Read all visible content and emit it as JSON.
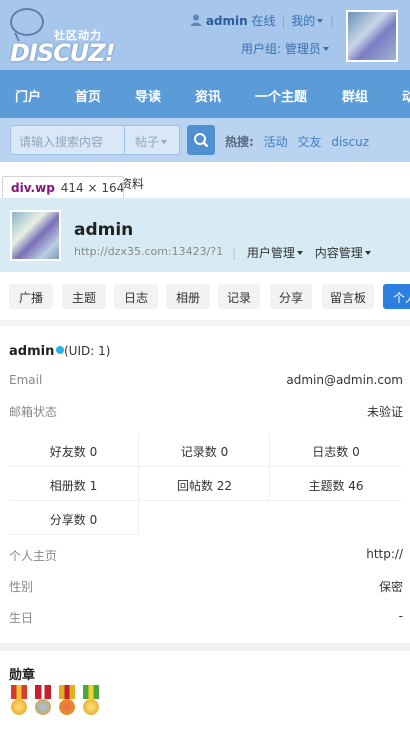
{
  "header": {
    "logo_cn": "社区动力",
    "logo_en": "DISCUZ!",
    "username": "admin",
    "online_status": "在线",
    "my_label": "我的",
    "user_group": "用户组: 管理员"
  },
  "nav": {
    "items": [
      "门户",
      "首页",
      "导读",
      "资讯",
      "一个主题",
      "群组",
      "动"
    ]
  },
  "search": {
    "placeholder": "请输入搜索内容",
    "type": "帖子",
    "hot_label": "热搜:",
    "hot_items": [
      "活动",
      "交友",
      "discuz"
    ]
  },
  "breadcrumb": {
    "tail": "资料"
  },
  "tooltip": {
    "element": "div.wp",
    "size": "414 × 164"
  },
  "profile": {
    "name": "admin",
    "url": "http://dzx35.com:13423/?1",
    "menu": [
      "用户管理",
      "内容管理"
    ]
  },
  "tabs": [
    "广播",
    "主题",
    "日志",
    "相册",
    "记录",
    "分享",
    "留言板",
    "个人"
  ],
  "info": {
    "name": "admin",
    "uid": "(UID: 1)",
    "rows_top": [
      {
        "key": "Email",
        "value": "admin@admin.com"
      },
      {
        "key": "邮箱状态",
        "value": "未验证"
      }
    ],
    "stats": [
      "好友数 0",
      "记录数 0",
      "日志数 0",
      "相册数 1",
      "回帖数 22",
      "主题数 46",
      "分享数 0"
    ],
    "rows_bottom": [
      {
        "key": "个人主页",
        "value": "http://"
      },
      {
        "key": "性别",
        "value": "保密"
      },
      {
        "key": "生日",
        "value": "-"
      }
    ]
  },
  "medals": {
    "title": "勋章",
    "colors": [
      "#d93a2b",
      "#e0b020",
      "#c7202a",
      "#4aa83a"
    ]
  },
  "colors": {
    "nav_bg": "#5b9bd8",
    "accent": "#2c7fe0",
    "profile_bg": "#d6ebf4"
  }
}
